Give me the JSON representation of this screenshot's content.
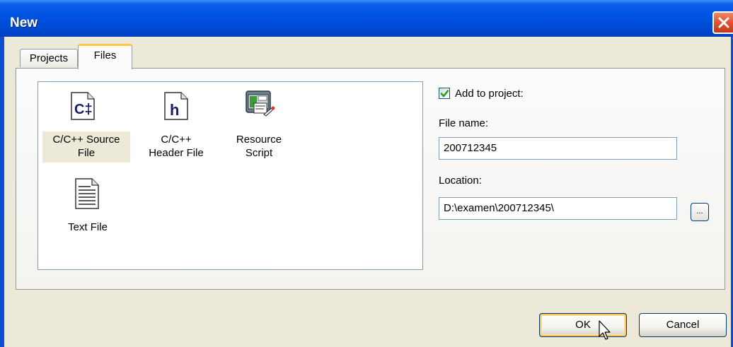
{
  "window": {
    "title": "New"
  },
  "tabs": [
    {
      "label": "Projects",
      "active": false
    },
    {
      "label": "Files",
      "active": true
    }
  ],
  "file_types": [
    {
      "line1": "C/C++ Source",
      "line2": "File",
      "icon": "cpp-source-file-icon",
      "icon_text": "C‡",
      "selected": true
    },
    {
      "line1": "C/C++",
      "line2": "Header File",
      "icon": "header-file-icon",
      "icon_text": "h",
      "selected": false
    },
    {
      "line1": "Resource",
      "line2": "Script",
      "icon": "resource-script-icon",
      "selected": false
    },
    {
      "line1": "Text File",
      "line2": "",
      "icon": "text-file-icon",
      "selected": false
    }
  ],
  "add_to_project": {
    "label": "Add to project:",
    "checked": true
  },
  "file_name": {
    "label": "File name:",
    "value": "200712345"
  },
  "location": {
    "label": "Location:",
    "value": "D:\\examen\\200712345\\",
    "browse_label": "..."
  },
  "buttons": {
    "ok": "OK",
    "cancel": "Cancel"
  },
  "colors": {
    "titlebar": "#0054e3",
    "dialog_bg": "#ece9d8",
    "active_tab_accent": "#ffc83c",
    "close_button": "#e0522e",
    "checkmark": "#21a121",
    "icon_letter": "#1a1a6e"
  }
}
